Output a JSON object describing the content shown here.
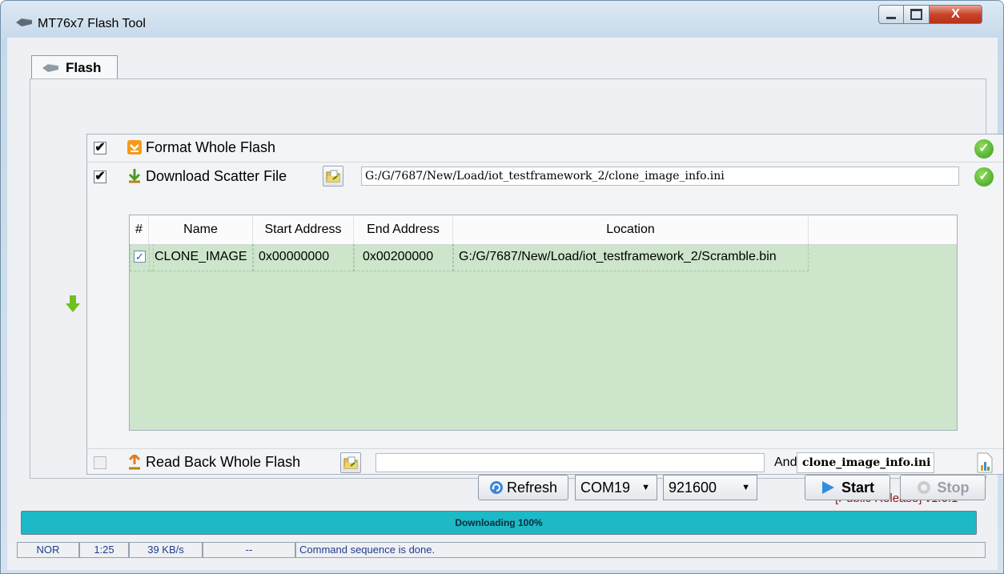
{
  "window": {
    "title": "MT76x7 Flash Tool",
    "close_glyph": "X"
  },
  "tabs": [
    {
      "label": "Flash"
    }
  ],
  "operations": {
    "format": {
      "label": "Format Whole Flash",
      "checked": true
    },
    "download": {
      "label": "Download Scatter File",
      "checked": true,
      "path": "G:/G/7687/New/Load/iot_testframework_2/clone_image_info.ini"
    },
    "readback": {
      "label": "Read Back Whole Flash",
      "checked": false,
      "path": "",
      "and_label": "And",
      "ini_name": "clone_image_info.ini"
    }
  },
  "table": {
    "columns": [
      "#",
      "Name",
      "Start Address",
      "End Address",
      "Location"
    ],
    "rows": [
      {
        "checked": true,
        "name": "CLONE_IMAGE",
        "start": "0x00000000",
        "end": "0x00200000",
        "location": "G:/G/7687/New/Load/iot_testframework_2/Scramble.bin"
      }
    ]
  },
  "release": "[Public Release] v1.0.1",
  "controls": {
    "refresh_label": "Refresh",
    "port": "COM19",
    "baud": "921600",
    "start_label": "Start",
    "stop_label": "Stop"
  },
  "progress": {
    "text": "Downloading  100%",
    "percent": 100,
    "color": "#1db9c6"
  },
  "statusbar": {
    "type": "NOR",
    "time": "1:25",
    "speed": "39 KB/s",
    "extra": "--",
    "message": "Command sequence is done."
  }
}
